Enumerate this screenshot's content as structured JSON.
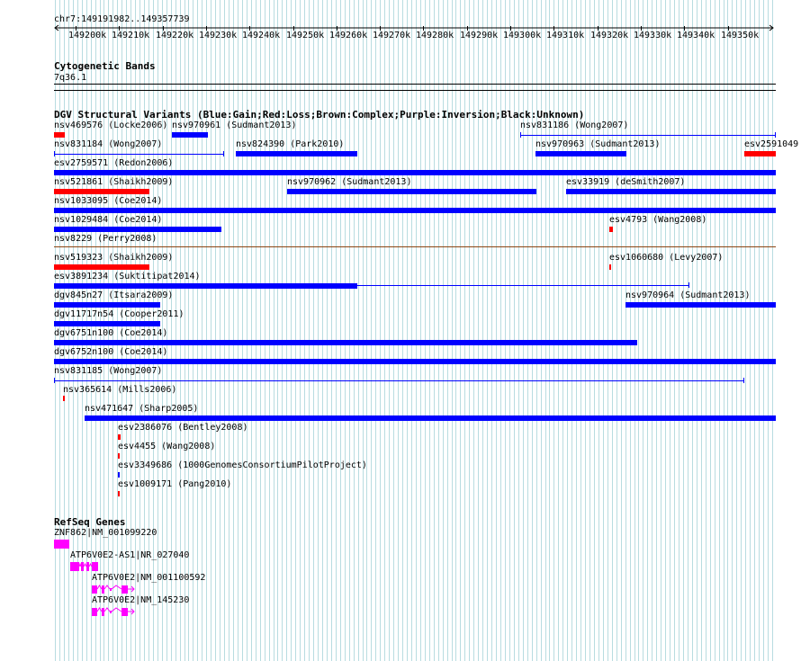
{
  "ruler": {
    "location": "chr7:149191982..149357739",
    "ticks": [
      "149200k",
      "149210k",
      "149220k",
      "149230k",
      "149240k",
      "149250k",
      "149260k",
      "149270k",
      "149280k",
      "149290k",
      "149300k",
      "149310k",
      "149320k",
      "149330k",
      "149340k",
      "149350k"
    ]
  },
  "cytobands": {
    "title": "Cytogenetic Bands",
    "band": "7q36.1"
  },
  "dgv": {
    "title": "DGV Structural Variants (Blue:Gain;Red:Loss;Brown:Complex;Purple:Inversion;Black:Unknown)",
    "variants": [
      {
        "label": "nsv469576 (Locke2006)",
        "color": "#ff0000"
      },
      {
        "label": "nsv970961 (Sudmant2013)",
        "color": "#0000ff"
      },
      {
        "label": "nsv831186 (Wong2007)",
        "color": "#0000ff"
      },
      {
        "label": "nsv831184 (Wong2007)",
        "color": "#0000ff"
      },
      {
        "label": "nsv824390 (Park2010)",
        "color": "#0000ff"
      },
      {
        "label": "nsv970963 (Sudmant2013)",
        "color": "#0000ff"
      },
      {
        "label": "esv2591049",
        "color": "#ff0000"
      },
      {
        "label": "esv2759571 (Redon2006)",
        "color": "#0000ff"
      },
      {
        "label": "nsv521861 (Shaikh2009)",
        "color": "#ff0000"
      },
      {
        "label": "nsv970962 (Sudmant2013)",
        "color": "#0000ff"
      },
      {
        "label": "esv33919 (deSmith2007)",
        "color": "#0000ff"
      },
      {
        "label": "nsv1033095 (Coe2014)",
        "color": "#0000ff"
      },
      {
        "label": "nsv1029484 (Coe2014)",
        "color": "#0000ff"
      },
      {
        "label": "esv4793 (Wang2008)",
        "color": "#ff0000"
      },
      {
        "label": "nsv8229 (Perry2008)",
        "color": "#8b4513"
      },
      {
        "label": "nsv519323 (Shaikh2009)",
        "color": "#ff0000"
      },
      {
        "label": "esv1060680 (Levy2007)",
        "color": "#ff0000"
      },
      {
        "label": "esv3891234 (Suktitipat2014)",
        "color": "#0000ff"
      },
      {
        "label": "dgv845n27 (Itsara2009)",
        "color": "#0000ff"
      },
      {
        "label": "nsv970964 (Sudmant2013)",
        "color": "#0000ff"
      },
      {
        "label": "dgv11717n54 (Cooper2011)",
        "color": "#0000ff"
      },
      {
        "label": "dgv6751n100 (Coe2014)",
        "color": "#0000ff"
      },
      {
        "label": "dgv6752n100 (Coe2014)",
        "color": "#0000ff"
      },
      {
        "label": "nsv831185 (Wong2007)",
        "color": "#0000ff"
      },
      {
        "label": "nsv365614 (Mills2006)",
        "color": "#ff0000"
      },
      {
        "label": "nsv471647 (Sharp2005)",
        "color": "#0000ff"
      },
      {
        "label": "esv2386076 (Bentley2008)",
        "color": "#ff0000"
      },
      {
        "label": "esv4455 (Wang2008)",
        "color": "#ff0000"
      },
      {
        "label": "esv3349686 (1000GenomesConsortiumPilotProject)",
        "color": "#0000ff"
      },
      {
        "label": "esv1009171 (Pang2010)",
        "color": "#ff0000"
      }
    ]
  },
  "refseq": {
    "title": "RefSeq Genes",
    "color": "#ff00ff",
    "genes": [
      {
        "label": "ZNF862|NM_001099220"
      },
      {
        "label": "ATP6V0E2-AS1|NR_027040"
      },
      {
        "label": "ATP6V0E2|NM_001100592"
      },
      {
        "label": "ATP6V0E2|NM_145230"
      }
    ]
  },
  "colors": {
    "grid_line": "#b8dce0",
    "gain": "#0000ff",
    "loss": "#ff0000",
    "complex": "#8b4513",
    "gene": "#ff00ff"
  }
}
